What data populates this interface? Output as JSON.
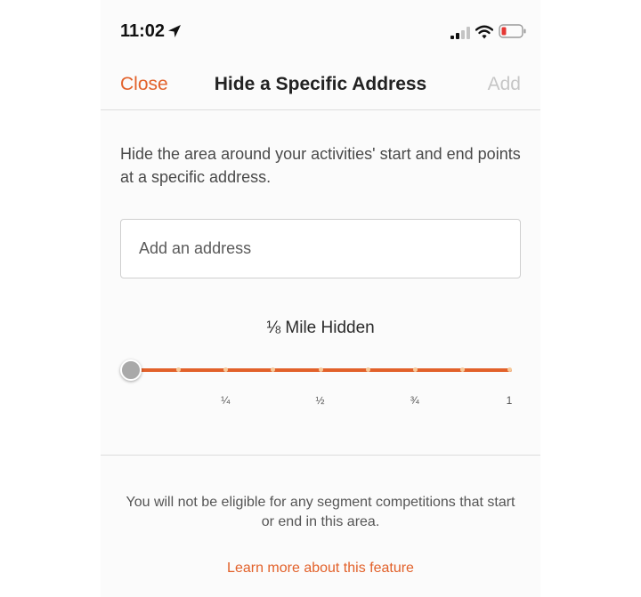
{
  "status_bar": {
    "time": "11:02",
    "location_icon": "location-arrow-icon",
    "signal_icon": "cellular-signal-icon",
    "wifi_icon": "wifi-icon",
    "battery_icon": "battery-low-icon",
    "battery_level": 0.15
  },
  "nav": {
    "close_label": "Close",
    "title": "Hide a Specific Address",
    "add_label": "Add"
  },
  "description": "Hide the area around your activities' start and end points at a specific address.",
  "address_input": {
    "placeholder": "Add an address",
    "value": ""
  },
  "slider": {
    "label": "⅛ Mile Hidden",
    "value": 0.125,
    "min": 0,
    "max": 1,
    "steps": 8,
    "ticks": [
      {
        "value": 0.25,
        "label": "¼"
      },
      {
        "value": 0.5,
        "label": "½"
      },
      {
        "value": 0.75,
        "label": "¾"
      },
      {
        "value": 1,
        "label": "1"
      }
    ]
  },
  "notice": "You will not be eligible for any segment competitions that start or end in this area.",
  "learn_more_label": "Learn more about this feature",
  "colors": {
    "accent": "#e2612a",
    "disabled": "#c6c6c6",
    "battery_low": "#e53935"
  }
}
